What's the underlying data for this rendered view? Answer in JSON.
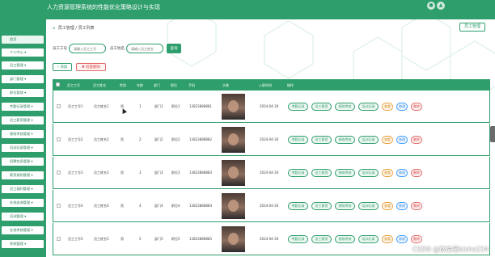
{
  "app": {
    "title": "人力资源管理系统的性能优化策略设计与实现"
  },
  "topbar_icons": [
    "bell-icon",
    "user-icon"
  ],
  "sidebar": {
    "items": [
      {
        "label": "首页"
      },
      {
        "label": "个人中心 ▾"
      },
      {
        "label": "员工管理 ▾"
      },
      {
        "label": "部门管理 ▾"
      },
      {
        "label": "职位管理 ▾"
      },
      {
        "label": "考勤记录管理 ▾"
      },
      {
        "label": "员工薪资管理 ▾"
      },
      {
        "label": "绩效考核管理 ▾"
      },
      {
        "label": "培训记录管理 ▾"
      },
      {
        "label": "招聘信息管理 ▾"
      },
      {
        "label": "薪资规则管理 ▾"
      },
      {
        "label": "员工福利管理 ▾"
      },
      {
        "label": "在线咨询管理 ▾"
      },
      {
        "label": "培训管理 ▾"
      },
      {
        "label": "在线考核管理 ▾"
      },
      {
        "label": "系统管理 ▾"
      }
    ]
  },
  "breadcrumb": {
    "home_icon": "home-icon",
    "items": [
      "员工管理",
      "员工列表"
    ]
  },
  "header_button": "员工管理",
  "search": {
    "fields": [
      {
        "label": "员工工号",
        "placeholder": "请输入员工工号"
      },
      {
        "label": "员工姓名",
        "placeholder": "请输入员工姓名"
      }
    ],
    "query_label": "查询"
  },
  "actions": {
    "add_label": "+ 添加",
    "delete_label": "✖ 批量删除"
  },
  "table": {
    "columns": [
      "员工工号",
      "员工姓名",
      "性别",
      "年龄",
      "部门",
      "职位",
      "手机",
      "头像",
      "入职时间",
      "操作"
    ],
    "rows": [
      {
        "id": "员工工号1",
        "name": "员工姓名1",
        "gender": "男",
        "age": "1",
        "dept": "部门1",
        "position": "职位1",
        "phone": "13823888881",
        "date": "2024-04-30"
      },
      {
        "id": "员工工号2",
        "name": "员工姓名2",
        "gender": "男",
        "age": "2",
        "dept": "部门2",
        "position": "职位2",
        "phone": "13823888882",
        "date": "2024-04-30"
      },
      {
        "id": "员工工号3",
        "name": "员工姓名3",
        "gender": "男",
        "age": "3",
        "dept": "部门3",
        "position": "职位3",
        "phone": "13823888883",
        "date": "2024-04-30"
      },
      {
        "id": "员工工号4",
        "name": "员工姓名4",
        "gender": "男",
        "age": "4",
        "dept": "部门4",
        "position": "职位4",
        "phone": "13823888884",
        "date": "2024-04-30"
      },
      {
        "id": "员工工号5",
        "name": "员工姓名5",
        "gender": "男",
        "age": "5",
        "dept": "部门5",
        "position": "职位5",
        "phone": "13823888885",
        "date": "2024-04-30"
      }
    ],
    "row_actions": [
      "考勤记录",
      "员工薪资",
      "绩效考核",
      "培训记录",
      "查看",
      "修改",
      "删除"
    ]
  },
  "watermark": "CSDN @微信是bishe234",
  "colors": {
    "primary": "#2e9e6c",
    "danger": "#d94a4a",
    "warning": "#d88a14",
    "info": "#2f86e0"
  }
}
